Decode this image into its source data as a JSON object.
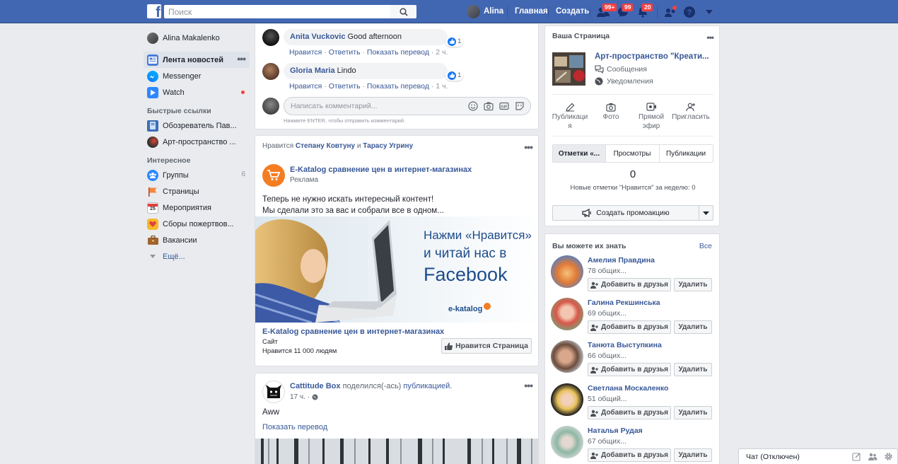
{
  "header": {
    "search_placeholder": "Поиск",
    "user_name": "Alina",
    "nav_home": "Главная",
    "nav_create": "Создать",
    "badge_friends": "99+",
    "badge_messages": "99",
    "badge_notifications": "20"
  },
  "left_nav": {
    "profile": "Alina Makalenko",
    "feed": "Лента новостей",
    "messenger": "Messenger",
    "watch": "Watch",
    "shortcuts_header": "Быстрые ссылки",
    "shortcuts": [
      "Обозреватель Пав...",
      "Арт-пространство ..."
    ],
    "explore_header": "Интересное",
    "groups": "Группы",
    "groups_count": "6",
    "pages": "Страницы",
    "events": "Мероприятия",
    "events_day": "25",
    "fundraisers": "Сборы пожертвов...",
    "jobs": "Вакансии",
    "more": "Ещё..."
  },
  "comments_card": {
    "comments": [
      {
        "author": "Anita Vuckovic",
        "text": "Good afternoon",
        "likes": "1",
        "like": "Нравится",
        "reply": "Ответить",
        "translate": "Показать перевод",
        "time": "2 ч."
      },
      {
        "author": "Gloria Maria",
        "text": "Lindo",
        "likes": "1",
        "like": "Нравится",
        "reply": "Ответить",
        "translate": "Показать перевод",
        "time": "1 ч."
      }
    ],
    "input_placeholder": "Написать комментарий...",
    "hint": "Нажмите ENTER, чтобы отправить комментарий."
  },
  "ad_post": {
    "liked_prefix": "Нравится",
    "liked_by_1": "Степану Ковтуну",
    "liked_and": "и",
    "liked_by_2": "Тарасу Угрину",
    "page_name": "E-Katalog сравнение цен в интернет-магазинах",
    "sponsored": "Реклама",
    "text_line1": "Теперь не нужно искать интересный контент!",
    "text_line2": "Мы сделали это за вас и собрали все в одном...",
    "image_line1": "Нажми «Нравится»",
    "image_line2": "и читай нас в",
    "image_line3": "Facebook",
    "image_brand": "e-katalog",
    "footer_title": "E-Katalog сравнение цен в интернет-магазинах",
    "footer_type": "Сайт",
    "footer_likes": "Нравится 11 000 людям",
    "like_page_button": "Нравится Страница"
  },
  "share_post": {
    "author": "Cattitude Box",
    "action": "поделился(-ась)",
    "object": "публикацией.",
    "time": "17 ч.",
    "text": "Aww",
    "translate": "Показать перевод"
  },
  "your_page": {
    "title": "Ваша Страница",
    "page_name": "Арт-пространство \"Креати...",
    "messages": "Сообщения",
    "notifications": "Уведомления",
    "tools": [
      {
        "line1": "Публикаци",
        "line2": "я"
      },
      {
        "line1": "Фото",
        "line2": ""
      },
      {
        "line1": "Прямой",
        "line2": "эфир"
      },
      {
        "line1": "Пригласить",
        "line2": ""
      }
    ],
    "tabs": [
      "Отметки «...",
      "Просмотры",
      "Публикации"
    ],
    "stat_value": "0",
    "stat_label": "Новые отметки \"Нравится\" за неделю: 0",
    "promo_button": "Создать промоакцию"
  },
  "pymk": {
    "title": "Вы можете их знать",
    "see_all": "Все",
    "add_label": "Добавить в друзья",
    "remove_label": "Удалить",
    "people": [
      {
        "name": "Амелия Правдина",
        "mutual": "78 общих..."
      },
      {
        "name": "Галина Рекшинська",
        "mutual": "69 общих..."
      },
      {
        "name": "Танюта Выступкина",
        "mutual": "66 общих..."
      },
      {
        "name": "Светлана Москаленко",
        "mutual": "51 общий..."
      },
      {
        "name": "Наталья Рудая",
        "mutual": "67 общих..."
      }
    ]
  },
  "chat": {
    "label": "Чат (Отключен)"
  },
  "colors": {
    "brand": "#4267b2",
    "link": "#385898",
    "badge": "#fa3e3e",
    "like": "#1877f2"
  }
}
